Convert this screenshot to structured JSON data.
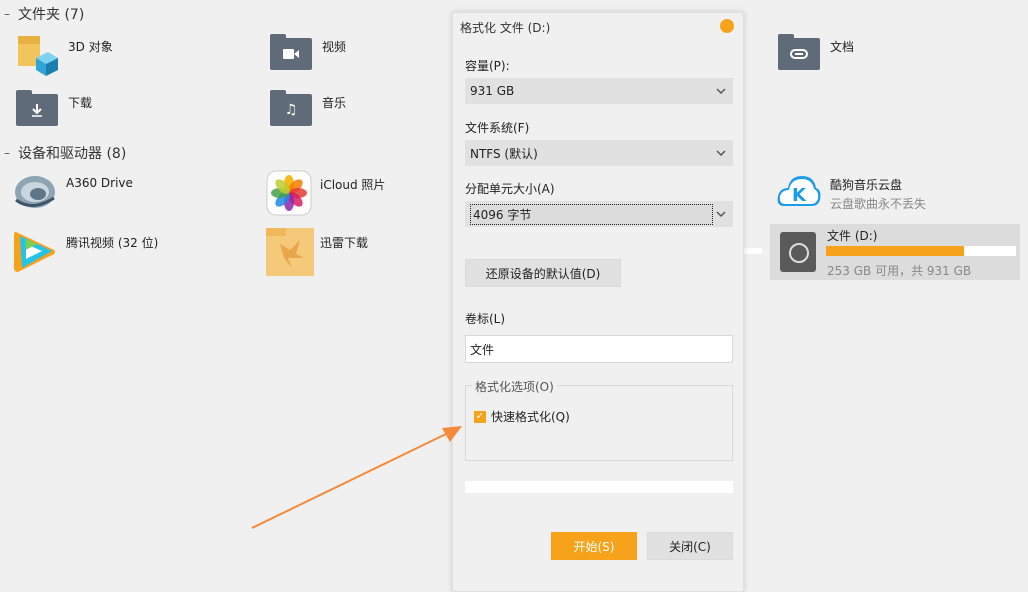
{
  "folders_section": {
    "header": "文件夹 (7)",
    "items": [
      {
        "name": "3D 对象",
        "icon": "3d-objects-icon"
      },
      {
        "name": "视频",
        "icon": "video-folder-icon"
      },
      {
        "name": "文档",
        "icon": "documents-folder-icon"
      },
      {
        "name": "下载",
        "icon": "downloads-folder-icon"
      },
      {
        "name": "音乐",
        "icon": "music-folder-icon"
      }
    ]
  },
  "devices_section": {
    "header": "设备和驱动器 (8)",
    "items": [
      {
        "name": "A360 Drive",
        "icon": "a360-drive-icon"
      },
      {
        "name": "iCloud 照片",
        "icon": "icloud-photos-icon"
      },
      {
        "name": "酷狗音乐云盘",
        "sub": "云盘歌曲永不丢失",
        "icon": "kugou-cloud-icon"
      },
      {
        "name": "腾讯视频 (32 位)",
        "icon": "tencent-video-icon"
      },
      {
        "name": "迅雷下载",
        "icon": "xunlei-download-icon"
      }
    ],
    "drive": {
      "name": "文件 (D:)",
      "free_text": "253 GB 可用，共 931 GB",
      "used_fraction": 0.728,
      "bar_color": "#f7a21b"
    }
  },
  "dialog": {
    "title": "格式化 文件 (D:)",
    "capacity_label": "容量(P):",
    "capacity_value": "931 GB",
    "filesystem_label": "文件系统(F)",
    "filesystem_value": "NTFS (默认)",
    "alloc_label": "分配单元大小(A)",
    "alloc_value": "4096 字节",
    "restore_button": "还原设备的默认值(D)",
    "volume_label": "卷标(L)",
    "volume_value": "文件",
    "options_legend": "格式化选项(O)",
    "quick_format_label": "快速格式化(Q)",
    "quick_format_checked": true,
    "start_button": "开始(S)",
    "close_button": "关闭(C)",
    "accent_color": "#f7a21b"
  }
}
